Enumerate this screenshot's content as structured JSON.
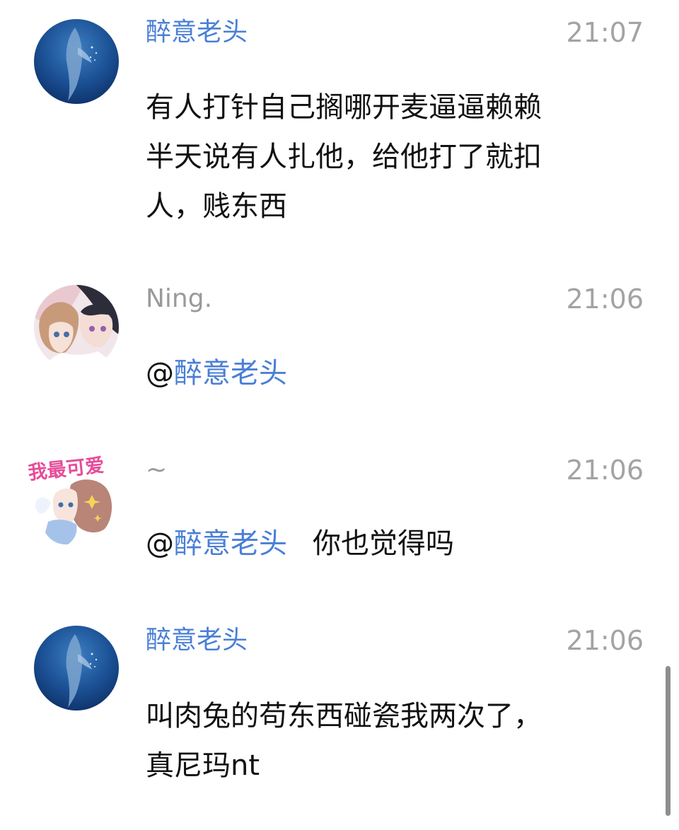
{
  "messages": [
    {
      "sender": "醉意老头",
      "time": "21:07",
      "lines": [
        "有人打针自己搁哪开麦逼逼赖赖",
        "半天说有人扎他，给他打了就扣",
        "人，贱东西"
      ]
    },
    {
      "sender": "Ning.",
      "time": "21:06",
      "mention_prefix": "@",
      "mention_name": "醉意老头"
    },
    {
      "sender": "~",
      "time": "21:06",
      "mention_prefix": "@",
      "mention_name": "醉意老头",
      "text": "你也觉得吗",
      "avatar_text": "我最可爱"
    },
    {
      "sender": "醉意老头",
      "time": "21:06",
      "lines": [
        "叫肉兔的苟东西碰瓷我两次了，",
        "真尼玛nt"
      ]
    }
  ],
  "colors": {
    "name_blue": "#4a7fd6",
    "name_gray": "#9a9a9a",
    "time_gray": "#a3a3a3",
    "text": "#111111"
  }
}
